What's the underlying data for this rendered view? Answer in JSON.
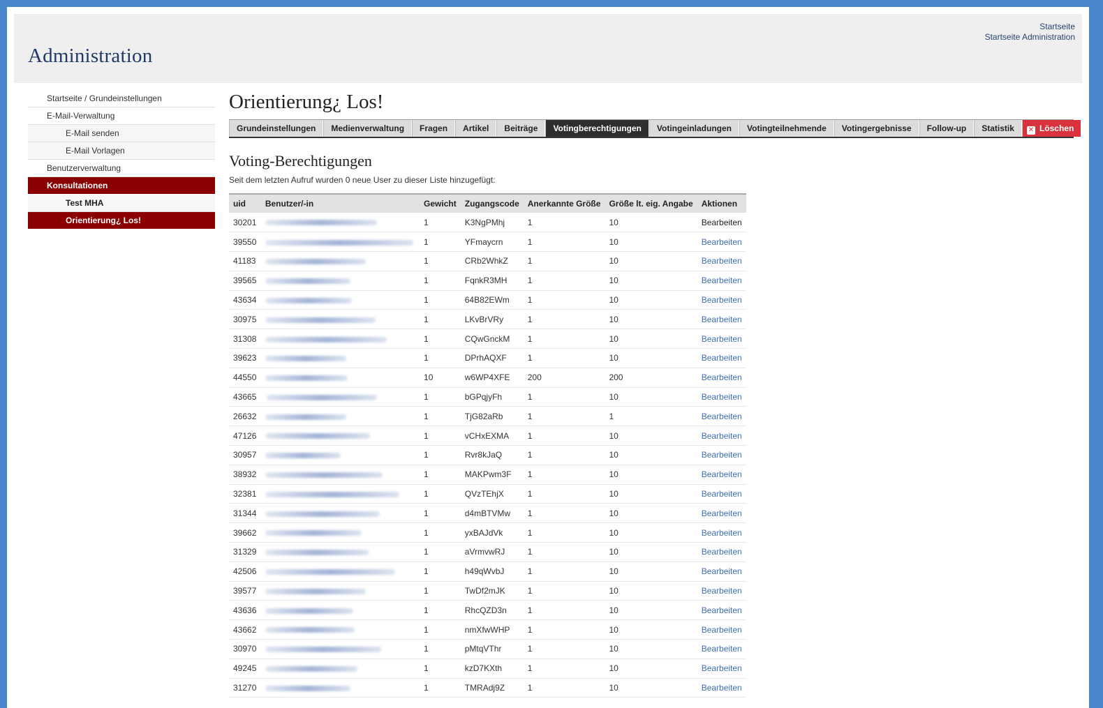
{
  "header": {
    "site_title": "Administration",
    "links": [
      "Startseite",
      "Startseite Administration"
    ]
  },
  "sidebar": {
    "items": [
      {
        "label": "Startseite / Grundeinstellungen",
        "level": 0,
        "state": "normal"
      },
      {
        "label": "E-Mail-Verwaltung",
        "level": 0,
        "state": "normal"
      },
      {
        "label": "E-Mail senden",
        "level": 1,
        "state": "normal"
      },
      {
        "label": "E-Mail Vorlagen",
        "level": 1,
        "state": "normal"
      },
      {
        "label": "Benutzerverwaltung",
        "level": 0,
        "state": "normal"
      },
      {
        "label": "Konsultationen",
        "level": 0,
        "state": "active"
      },
      {
        "label": "Test MHA",
        "level": 1,
        "state": "bold"
      },
      {
        "label": "Orientierung¿ Los!",
        "level": 1,
        "state": "active"
      }
    ]
  },
  "main": {
    "page_title": "Orientierung¿ Los!",
    "tabs": [
      {
        "label": "Grundeinstellungen",
        "state": "normal"
      },
      {
        "label": "Medienverwaltung",
        "state": "normal"
      },
      {
        "label": "Fragen",
        "state": "normal"
      },
      {
        "label": "Artikel",
        "state": "normal"
      },
      {
        "label": "Beiträge",
        "state": "normal"
      },
      {
        "label": "Votingberechtigungen",
        "state": "active"
      },
      {
        "label": "Votingeinladungen",
        "state": "normal"
      },
      {
        "label": "Votingteilnehmende",
        "state": "normal"
      },
      {
        "label": "Votingergebnisse",
        "state": "normal"
      },
      {
        "label": "Follow-up",
        "state": "normal"
      },
      {
        "label": "Statistik",
        "state": "normal"
      },
      {
        "label": "Löschen",
        "state": "danger"
      }
    ],
    "section_title": "Voting-Berechtigungen",
    "intro": "Seit dem letzten Aufruf wurden 0 neue User zu dieser Liste hinzugefügt:",
    "table": {
      "columns": [
        "uid",
        "Benutzer/-in",
        "Gewicht",
        "Zugangscode",
        "Anerkannte Größe",
        "Größe lt. eig. Angabe",
        "Aktionen"
      ],
      "rows": [
        {
          "uid": "30201",
          "gewicht": "1",
          "code": "K3NgPMhj",
          "anerkannt": "1",
          "angabe": "10",
          "action": "Bearbeiten"
        },
        {
          "uid": "39550",
          "gewicht": "1",
          "code": "YFmaycrn",
          "anerkannt": "1",
          "angabe": "10",
          "action": "Bearbeiten"
        },
        {
          "uid": "41183",
          "gewicht": "1",
          "code": "CRb2WhkZ",
          "anerkannt": "1",
          "angabe": "10",
          "action": "Bearbeiten"
        },
        {
          "uid": "39565",
          "gewicht": "1",
          "code": "FqnkR3MH",
          "anerkannt": "1",
          "angabe": "10",
          "action": "Bearbeiten"
        },
        {
          "uid": "43634",
          "gewicht": "1",
          "code": "64B82EWm",
          "anerkannt": "1",
          "angabe": "10",
          "action": "Bearbeiten"
        },
        {
          "uid": "30975",
          "gewicht": "1",
          "code": "LKvBrVRy",
          "anerkannt": "1",
          "angabe": "10",
          "action": "Bearbeiten"
        },
        {
          "uid": "31308",
          "gewicht": "1",
          "code": "CQwGnckM",
          "anerkannt": "1",
          "angabe": "10",
          "action": "Bearbeiten"
        },
        {
          "uid": "39623",
          "gewicht": "1",
          "code": "DPrhAQXF",
          "anerkannt": "1",
          "angabe": "10",
          "action": "Bearbeiten"
        },
        {
          "uid": "44550",
          "gewicht": "10",
          "code": "w6WP4XFE",
          "anerkannt": "200",
          "angabe": "200",
          "action": "Bearbeiten"
        },
        {
          "uid": "43665",
          "gewicht": "1",
          "code": "bGPqjyFh",
          "anerkannt": "1",
          "angabe": "10",
          "action": "Bearbeiten"
        },
        {
          "uid": "26632",
          "gewicht": "1",
          "code": "TjG82aRb",
          "anerkannt": "1",
          "angabe": "1",
          "action": "Bearbeiten"
        },
        {
          "uid": "47126",
          "gewicht": "1",
          "code": "vCHxEXMA",
          "anerkannt": "1",
          "angabe": "10",
          "action": "Bearbeiten"
        },
        {
          "uid": "30957",
          "gewicht": "1",
          "code": "Rvr8kJaQ",
          "anerkannt": "1",
          "angabe": "10",
          "action": "Bearbeiten"
        },
        {
          "uid": "38932",
          "gewicht": "1",
          "code": "MAKPwm3F",
          "anerkannt": "1",
          "angabe": "10",
          "action": "Bearbeiten"
        },
        {
          "uid": "32381",
          "gewicht": "1",
          "code": "QVzTEhjX",
          "anerkannt": "1",
          "angabe": "10",
          "action": "Bearbeiten"
        },
        {
          "uid": "31344",
          "gewicht": "1",
          "code": "d4mBTVMw",
          "anerkannt": "1",
          "angabe": "10",
          "action": "Bearbeiten"
        },
        {
          "uid": "39662",
          "gewicht": "1",
          "code": "yxBAJdVk",
          "anerkannt": "1",
          "angabe": "10",
          "action": "Bearbeiten"
        },
        {
          "uid": "31329",
          "gewicht": "1",
          "code": "aVrmvwRJ",
          "anerkannt": "1",
          "angabe": "10",
          "action": "Bearbeiten"
        },
        {
          "uid": "42506",
          "gewicht": "1",
          "code": "h49qWvbJ",
          "anerkannt": "1",
          "angabe": "10",
          "action": "Bearbeiten"
        },
        {
          "uid": "39577",
          "gewicht": "1",
          "code": "TwDf2mJK",
          "anerkannt": "1",
          "angabe": "10",
          "action": "Bearbeiten"
        },
        {
          "uid": "43636",
          "gewicht": "1",
          "code": "RhcQZD3n",
          "anerkannt": "1",
          "angabe": "10",
          "action": "Bearbeiten"
        },
        {
          "uid": "43662",
          "gewicht": "1",
          "code": "nmXfwWHP",
          "anerkannt": "1",
          "angabe": "10",
          "action": "Bearbeiten"
        },
        {
          "uid": "30970",
          "gewicht": "1",
          "code": "pMtqVThr",
          "anerkannt": "1",
          "angabe": "10",
          "action": "Bearbeiten"
        },
        {
          "uid": "49245",
          "gewicht": "1",
          "code": "kzD7KXth",
          "anerkannt": "1",
          "angabe": "10",
          "action": "Bearbeiten"
        },
        {
          "uid": "31270",
          "gewicht": "1",
          "code": "TMRAdj9Z",
          "anerkannt": "1",
          "angabe": "10",
          "action": "Bearbeiten"
        }
      ]
    }
  },
  "colors": {
    "background_border": "#4a86cc",
    "header_bg": "#efefef",
    "active_nav": "#8a0000",
    "active_tab": "#2e2e2e",
    "danger_tab": "#d8323c",
    "link": "#3d6fb5"
  }
}
